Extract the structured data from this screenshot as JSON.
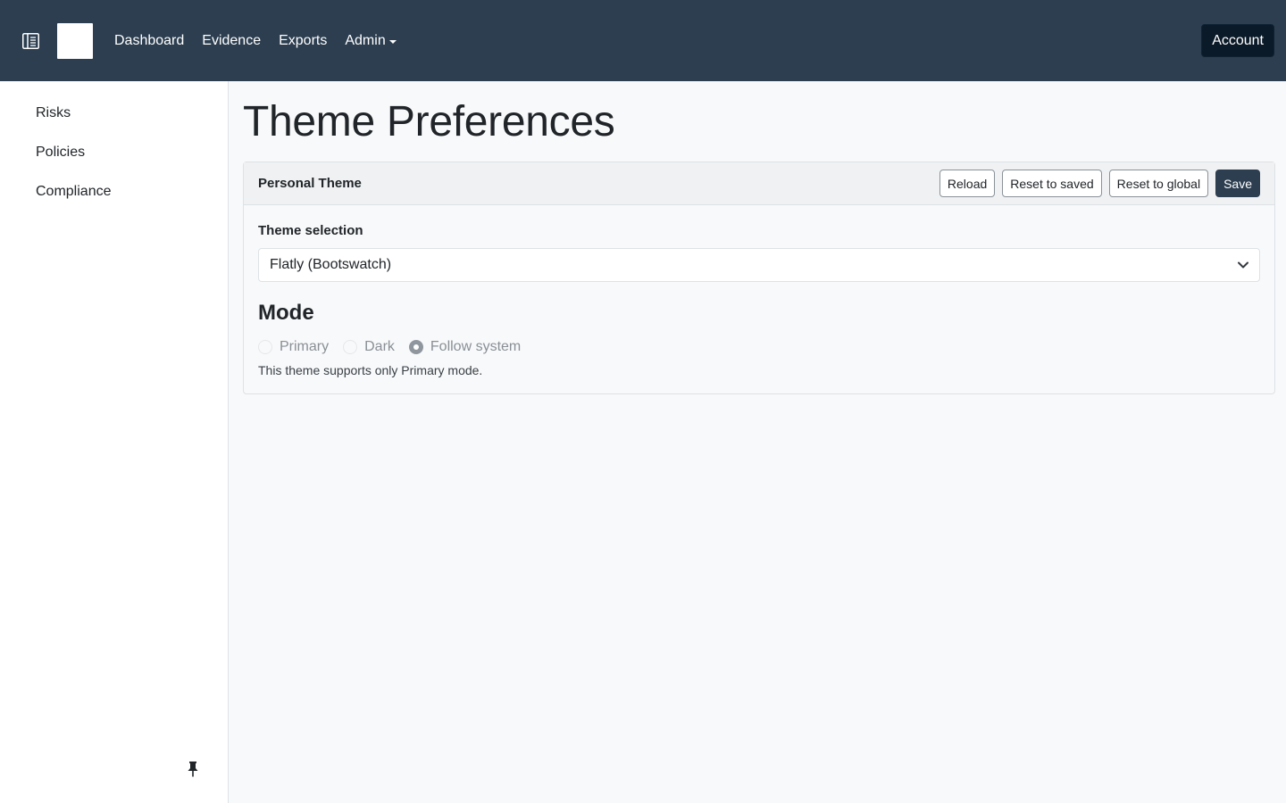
{
  "navbar": {
    "links": [
      {
        "label": "Dashboard"
      },
      {
        "label": "Evidence"
      },
      {
        "label": "Exports"
      },
      {
        "label": "Admin"
      }
    ],
    "account_label": "Account",
    "background_color": "#2c3e50"
  },
  "sidebar": {
    "items": [
      {
        "label": "Risks"
      },
      {
        "label": "Policies"
      },
      {
        "label": "Compliance"
      }
    ],
    "pin_icon": "pin-icon"
  },
  "page": {
    "title": "Theme Preferences"
  },
  "card": {
    "title": "Personal Theme",
    "buttons": {
      "reload": "Reload",
      "reset_saved": "Reset to saved",
      "reset_global": "Reset to global",
      "save": "Save"
    },
    "theme_label": "Theme selection",
    "theme_value": "Flatly (Bootswatch)",
    "mode_heading": "Mode",
    "mode_options": [
      {
        "label": "Primary",
        "checked": false,
        "disabled": true
      },
      {
        "label": "Dark",
        "checked": false,
        "disabled": true
      },
      {
        "label": "Follow system",
        "checked": true,
        "disabled": true
      }
    ],
    "help_text": "This theme supports only Primary mode."
  },
  "colors": {
    "primary": "#2c3e50",
    "background": "#f8f9fa"
  }
}
